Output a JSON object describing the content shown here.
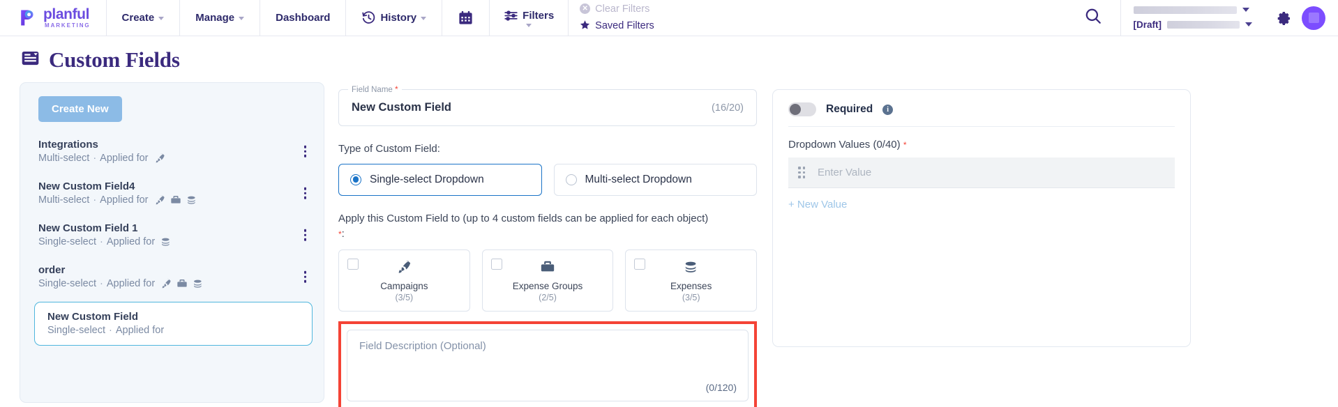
{
  "brand": {
    "accent": "#6b4ce0",
    "name": "planful",
    "tagline": "MARKETING"
  },
  "topnav": {
    "items": [
      {
        "label": "Create",
        "icon": "chevron-down-icon"
      },
      {
        "label": "Manage",
        "icon": "chevron-down-icon"
      },
      {
        "label": "Dashboard",
        "icon": "none"
      },
      {
        "label": "History",
        "icon": "history-clock-icon"
      }
    ],
    "calendar_icon": "calendar-icon",
    "filters_label": "Filters",
    "clear_filters_label": "Clear Filters",
    "saved_filters_label": "Saved Filters",
    "search_icon": "search-icon",
    "gear_icon": "gear-icon",
    "draft_tag": "[Draft]",
    "avatar_icon": "avatar"
  },
  "page": {
    "title": "Custom Fields",
    "title_icon": "custom-fields-icon"
  },
  "list_panel": {
    "create_button": "Create New",
    "items": [
      {
        "name": "Integrations",
        "type": "Multi-select",
        "applied_label": "Applied for",
        "objects": [
          "rocket"
        ],
        "selected": false
      },
      {
        "name": "New Custom Field4",
        "type": "Multi-select",
        "applied_label": "Applied for",
        "objects": [
          "rocket",
          "briefcase",
          "coins"
        ],
        "selected": false
      },
      {
        "name": "New Custom Field 1",
        "type": "Single-select",
        "applied_label": "Applied for",
        "objects": [
          "coins"
        ],
        "selected": false
      },
      {
        "name": "order",
        "type": "Single-select",
        "applied_label": "Applied for",
        "objects": [
          "rocket",
          "briefcase",
          "coins"
        ],
        "selected": false
      },
      {
        "name": "New Custom Field",
        "type": "Single-select",
        "applied_label": "Applied for",
        "objects": [],
        "selected": true
      }
    ],
    "separator": "·"
  },
  "form": {
    "field_name_label": "Field Name",
    "field_name_value": "New Custom Field",
    "field_name_counter": "(16/20)",
    "type_label": "Type of Custom Field:",
    "type_options": [
      {
        "label": "Single-select Dropdown",
        "checked": true
      },
      {
        "label": "Multi-select Dropdown",
        "checked": false
      }
    ],
    "apply_label": "Apply this Custom Field to (up to 4 custom fields can be applied for each object)",
    "apply_suffix": ":",
    "objects": [
      {
        "name": "Campaigns",
        "count": "(3/5)",
        "icon": "rocket-icon",
        "checked": false
      },
      {
        "name": "Expense Groups",
        "count": "(2/5)",
        "icon": "briefcase-icon",
        "checked": false
      },
      {
        "name": "Expenses",
        "count": "(3/5)",
        "icon": "coins-icon",
        "checked": false
      }
    ],
    "description_placeholder": "Field Description (Optional)",
    "description_counter": "(0/120)",
    "highlight_color": "#f44336"
  },
  "right_panel": {
    "required_label": "Required",
    "required_on": false,
    "info_icon": "info-icon",
    "dropdown_values_label": "Dropdown Values (0/40)",
    "value_placeholder": "Enter Value",
    "new_value_label": "+ New Value"
  }
}
